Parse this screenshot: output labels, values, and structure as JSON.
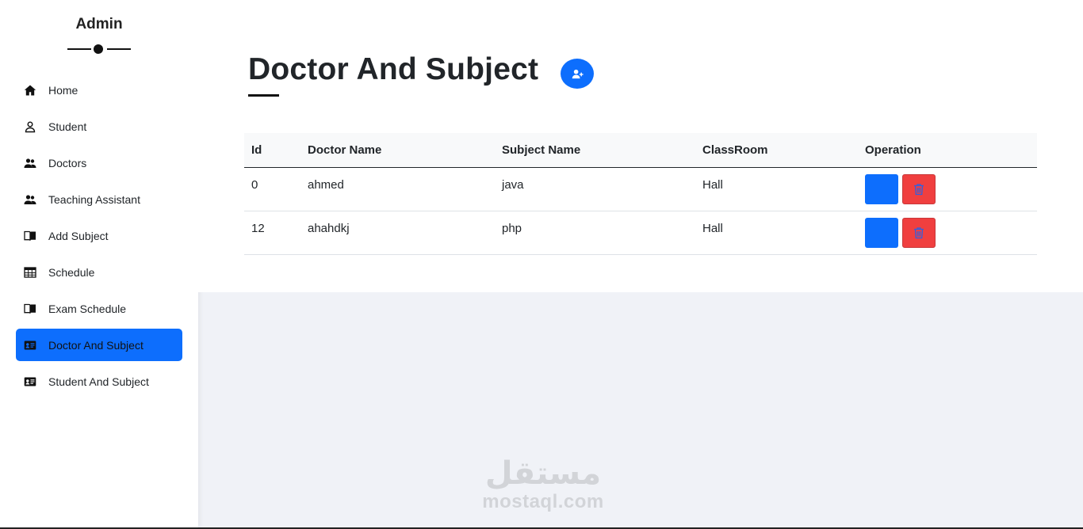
{
  "sidebar": {
    "brand": "Admin",
    "items": [
      {
        "label": "Home",
        "icon": "home-icon",
        "active": false
      },
      {
        "label": "Student",
        "icon": "user-icon",
        "active": false
      },
      {
        "label": "Doctors",
        "icon": "users-icon",
        "active": false
      },
      {
        "label": "Teaching Assistant",
        "icon": "users-icon",
        "active": false
      },
      {
        "label": "Add Subject",
        "icon": "book-icon",
        "active": false
      },
      {
        "label": "Schedule",
        "icon": "table-icon",
        "active": false
      },
      {
        "label": "Exam Schedule",
        "icon": "book-icon",
        "active": false
      },
      {
        "label": "Doctor And Subject",
        "icon": "id-card-icon",
        "active": true
      },
      {
        "label": "Student And Subject",
        "icon": "id-card-icon",
        "active": false
      }
    ]
  },
  "main": {
    "title": "Doctor And Subject",
    "add_icon": "user-plus-icon",
    "table": {
      "headers": [
        "Id",
        "Doctor Name",
        "Subject Name",
        "ClassRoom",
        "Operation"
      ],
      "rows": [
        {
          "id": "0",
          "doctor": "ahmed",
          "subject": "java",
          "room": "Hall"
        },
        {
          "id": "12",
          "doctor": "ahahdkj",
          "subject": "php",
          "room": "Hall"
        }
      ]
    }
  },
  "watermark": {
    "arabic": "مستقل",
    "latin": "mostaql.com"
  },
  "colors": {
    "primary": "#0d6efd",
    "danger": "#f03f3f",
    "background": "#f0f2f7"
  }
}
